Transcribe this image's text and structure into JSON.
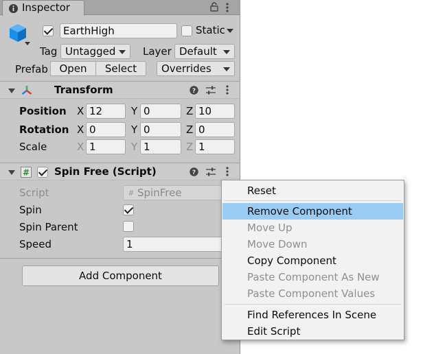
{
  "window": {
    "tab_title": "Inspector"
  },
  "gameobject": {
    "name": "EarthHigh",
    "active": true,
    "static_label": "Static",
    "static_checked": false,
    "tag_label": "Tag",
    "tag_value": "Untagged",
    "layer_label": "Layer",
    "layer_value": "Default",
    "prefab_label": "Prefab",
    "prefab_open": "Open",
    "prefab_select": "Select",
    "prefab_overrides": "Overrides"
  },
  "transform": {
    "title": "Transform",
    "rows": [
      {
        "label": "Position",
        "x": "12",
        "y": "0",
        "z": "10"
      },
      {
        "label": "Rotation",
        "x": "0",
        "y": "0",
        "z": "0"
      },
      {
        "label": "Scale",
        "x": "1",
        "y": "1",
        "z": "1"
      }
    ],
    "axis": {
      "x": "X",
      "y": "Y",
      "z": "Z"
    }
  },
  "spin_free": {
    "title": "Spin Free (Script)",
    "enabled": true,
    "script_label": "Script",
    "script_value": "SpinFree",
    "spin_label": "Spin",
    "spin_checked": true,
    "spin_parent_label": "Spin Parent",
    "spin_parent_checked": false,
    "speed_label": "Speed",
    "speed_value": "1"
  },
  "add_component_label": "Add Component",
  "context_menu": {
    "items": [
      {
        "label": "Reset",
        "enabled": true,
        "highlighted": false
      },
      {
        "label": "Remove Component",
        "enabled": true,
        "highlighted": true
      },
      {
        "label": "Move Up",
        "enabled": false,
        "highlighted": false
      },
      {
        "label": "Move Down",
        "enabled": false,
        "highlighted": false
      },
      {
        "label": "Copy Component",
        "enabled": true,
        "highlighted": false
      },
      {
        "label": "Paste Component As New",
        "enabled": false,
        "highlighted": false
      },
      {
        "label": "Paste Component Values",
        "enabled": false,
        "highlighted": false
      },
      {
        "label": "Find References In Scene",
        "enabled": true,
        "highlighted": false
      },
      {
        "label": "Edit Script",
        "enabled": true,
        "highlighted": false
      }
    ]
  },
  "colors": {
    "panel_bg": "#c8c8c8",
    "menu_highlight": "#99cbf3",
    "gameobject_icon": "#1a8fe8"
  }
}
